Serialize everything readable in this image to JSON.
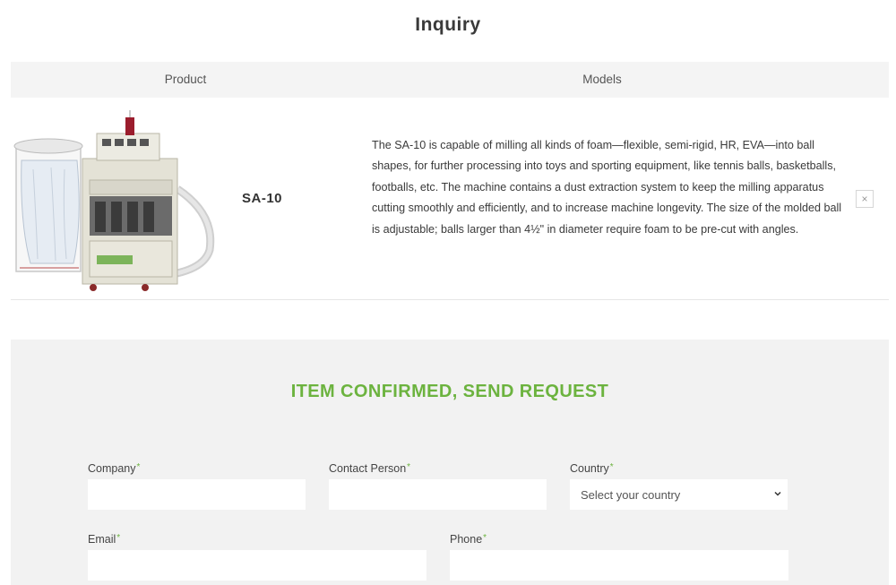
{
  "page": {
    "title": "Inquiry"
  },
  "table": {
    "headers": {
      "product": "Product",
      "models": "Models"
    }
  },
  "item": {
    "model": "SA-10",
    "description": "The SA-10 is capable of milling all kinds of foam—flexible, semi-rigid, HR, EVA—into ball shapes, for further processing into toys and sporting equipment, like tennis balls, basketballs, footballs, etc. The machine contains a dust extraction system to keep the milling apparatus cutting smoothly and efficiently, and to increase machine longevity. The size of the molded ball is adjustable; balls larger than 4½\" in diameter require foam to be pre-cut with angles.",
    "remove_label": "×"
  },
  "form": {
    "title": "ITEM CONFIRMED, SEND REQUEST",
    "required_mark": "*",
    "company_label": "Company",
    "contact_label": "Contact Person",
    "country_label": "Country",
    "country_placeholder": "Select your country",
    "email_label": "Email",
    "phone_label": "Phone"
  },
  "colors": {
    "accent": "#6cb33f",
    "header_bg": "#f4f4f4",
    "form_bg": "#f2f2f2"
  }
}
